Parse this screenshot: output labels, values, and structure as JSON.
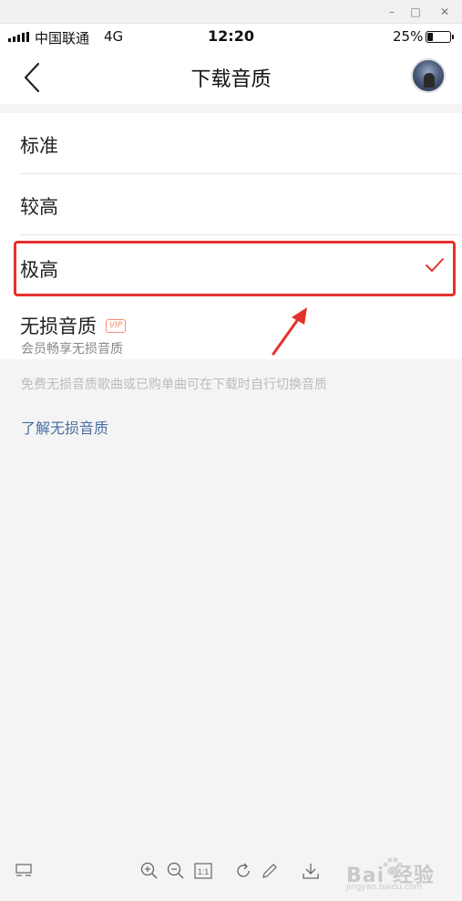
{
  "window": {
    "min_glyph": "–",
    "max_glyph": "□",
    "close_glyph": "✕"
  },
  "status_bar": {
    "carrier": "中国联通",
    "network": "4G",
    "time": "12:20",
    "battery_pct": "25%",
    "battery_level": 0.25
  },
  "nav": {
    "title": "下载音质"
  },
  "options": [
    {
      "label": "标准",
      "selected": false
    },
    {
      "label": "较高",
      "selected": false
    },
    {
      "label": "极高",
      "selected": true
    },
    {
      "label": "无损音质",
      "badge": "VIP",
      "subtitle": "会员畅享无损音质",
      "selected": false
    }
  ],
  "note": "免费无损音质歌曲或已购单曲可在下载时自行切换音质",
  "link": "了解无损音质",
  "colors": {
    "accent": "#e5312d",
    "link": "#4a6fa0",
    "vip": "#f08d74"
  },
  "toolbar": {
    "icons": [
      "layout-icon",
      "zoom-in-icon",
      "zoom-out-icon",
      "actual-size-icon",
      "rotate-icon",
      "edit-icon",
      "download-icon"
    ],
    "actual_size_label": "1:1"
  },
  "watermark": {
    "text": "Bai  经验",
    "sub": "jingyan.baidu.com"
  }
}
